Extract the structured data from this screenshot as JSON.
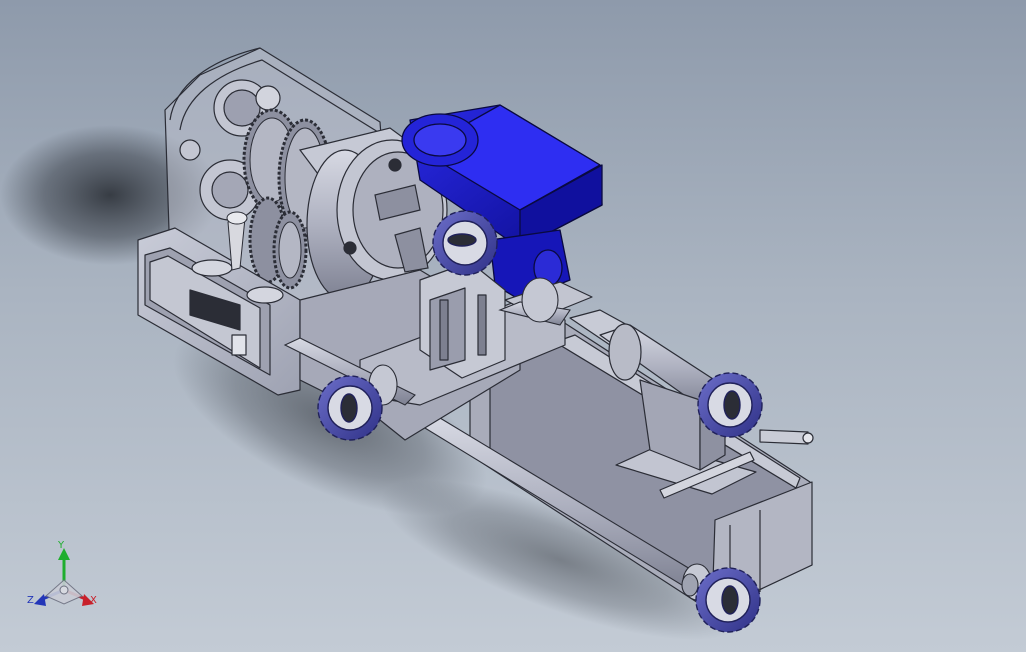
{
  "viewport": {
    "background_top": "#8e9aab",
    "background_bottom": "#c3cbd5",
    "part_color": "#b9bcc9",
    "edge_color": "#2b2d36",
    "motor_color": "#1a1ac8",
    "handwheel_color": "#4b4dae"
  },
  "triad": {
    "x_label": "X",
    "y_label": "Y",
    "z_label": "Z",
    "x_color": "#c8202a",
    "y_color": "#1fae2e",
    "z_color": "#2336b8"
  }
}
